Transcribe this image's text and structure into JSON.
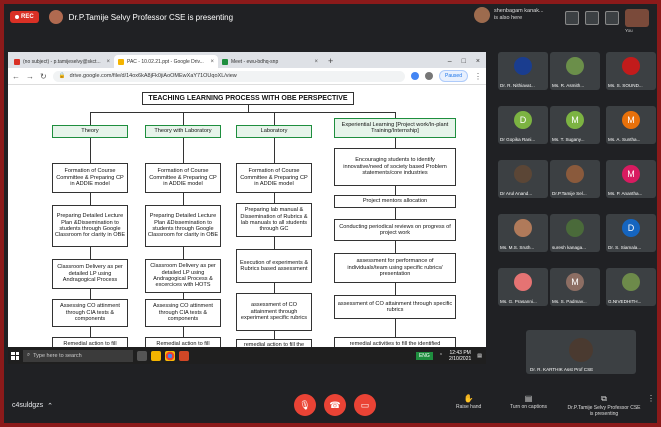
{
  "meet": {
    "rec_label": "REC",
    "presenting_text": "Dr.P.Tamije Selvy Professor CSE is presenting",
    "notification": {
      "line1": "shenbagam kanak...",
      "line2": "is also here"
    },
    "self_label": "You",
    "meeting_code": "c4suldgzs",
    "raise_hand": "Raise hand",
    "captions": "Turn on captions",
    "presenting_ctrl": "Dr.P.Tamije Selvy Professor CSE is presenting"
  },
  "browser": {
    "tabs": [
      {
        "label": "(no subject) - p.tamijeselvy@skct...",
        "icon_color": "#d93025"
      },
      {
        "label": "PAC - 10.02.21.ppt - Google Driv...",
        "icon_color": "#f4b400"
      },
      {
        "label": "Meet - ewu-bdhq-snp",
        "icon_color": "#1e8e3e"
      }
    ],
    "url": "drive.google.com/file/d/14ox6kA8jFk0jiAoOMEwXaY71OUqoXL/view",
    "paused": "Paused"
  },
  "slide": {
    "title": "TEACHING LEARNING PROCESS WITH OBE PERSPECTIVE",
    "col1": [
      "Theory",
      "Formation of Course Committee & Preparing CP in ADDIE model",
      "Preparing Detailed Lecture Plan &Dissemination to students through Google Classroom for clarity in OBE",
      "Classroom Delivery as per detailed LP using Andragogical Process",
      "Assessing CO attinment through CIA tests & components",
      "Remedial action to fill"
    ],
    "col2": [
      "Theory with Laboratory",
      "Formation of Course Committee & Preparing CP in ADDIE model",
      "Preparing Detailed Lecture Plan &Dissemination to students through Google Classroom for clarity in OBE",
      "Classroom Delivery as per detailed LP using Andragogical Process & excercices with HOTS",
      "Assessing CO attinment through CIA tests & components",
      "Remedial action to fill"
    ],
    "col3": [
      "Laboratory",
      "Formation of Course Committee & Preparing CP in ADDIE model",
      "Preparing lab manual & Dissemination of Rubrics & lab manuals to all students through GC",
      "Execution of experiments & Rubrics based assessment",
      "assessment of CO attainment through experiment specific rubrics",
      "remedial action to fill the"
    ],
    "col4": [
      "Experiential Learning [Project work/In-plant Training/Internship]",
      "Encouraging students to identify innovative/need of society based Problem statements/core industries",
      "Project mentors allocation",
      "Conducting periodical reviews on progress of project work",
      "assessment for performance of individuals/team using specific rubrics/ presentation",
      "assessment of CO attainment through specific rubrics",
      "remedial activities to fill the identified"
    ]
  },
  "taskbar": {
    "search": "Type here to search",
    "badge": "ENG",
    "time": "12:43 PM",
    "date": "2/10/2021"
  },
  "participants": [
    {
      "name": "Dr. R. Nithiavat...",
      "initial": "",
      "color": "#1a3d8f"
    },
    {
      "name": "Ms. R. Asmith...",
      "initial": "",
      "color": "#6b8f4a"
    },
    {
      "name": "Ms. S. SOUND...",
      "initial": "",
      "color": "#c21b1b"
    },
    {
      "name": "Dr Gopika Rani...",
      "initial": "D",
      "color": "#7cb342"
    },
    {
      "name": "Ms. T. Sugany...",
      "initial": "M",
      "color": "#7cb342"
    },
    {
      "name": "Ms. A. Suntha...",
      "initial": "M",
      "color": "#e8710a"
    },
    {
      "name": "Dr Arul Anand...",
      "initial": "",
      "color": "#5b4636"
    },
    {
      "name": "Dr.P.Tamije Sel...",
      "initial": "",
      "color": "#8a5a3c"
    },
    {
      "name": "Ms. P. Anantha...",
      "initial": "M",
      "color": "#d81b60"
    },
    {
      "name": "Ms. M.S. Sruth...",
      "initial": "",
      "color": "#b07a5a"
    },
    {
      "name": "suresh kanaga...",
      "initial": "",
      "color": "#4a6a3a"
    },
    {
      "name": "Dr. S. Siamala...",
      "initial": "D",
      "color": "#1565c0"
    },
    {
      "name": "Ms. G. Prasanni...",
      "initial": "",
      "color": "#e57373"
    },
    {
      "name": "Ms. S. Padmav...",
      "initial": "M",
      "color": "#8d6e63"
    },
    {
      "name": "G.NIVEDHITH...",
      "initial": "",
      "color": "#6d8a4a"
    }
  ],
  "big_tile_name": "Dr. R. KARTHIK Asst Prof CSE"
}
